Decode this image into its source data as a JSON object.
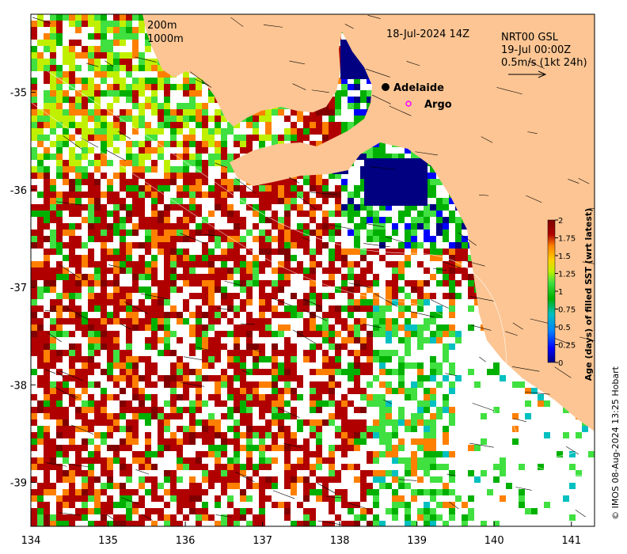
{
  "map": {
    "date_label": "18-Jul-2024 14Z",
    "depth_contours": [
      "200m",
      "1000m"
    ],
    "product_label": "NRT00 GSL",
    "current_time": "19-Jul 00:00Z",
    "vector_scale": "0.5m/s (1kt 24h)",
    "x_ticks": [
      "134",
      "135",
      "136",
      "137",
      "138",
      "139",
      "140",
      "141"
    ],
    "y_ticks": [
      "-35",
      "-36",
      "-37",
      "-38",
      "-39"
    ],
    "x_range": [
      134,
      141.3
    ],
    "y_range": [
      -39.45,
      -34.2
    ],
    "places": [
      {
        "name": "Adelaide",
        "lon": 138.6,
        "lat": -34.93,
        "marker": "filled-circle"
      },
      {
        "name": "Argo",
        "lon": 138.85,
        "lat": -35.13,
        "marker": "open-circle"
      }
    ],
    "land_color": "#fcc593",
    "credit": "© IMOS 08-Aug-2024 13:25 Hobart"
  },
  "colorbar": {
    "title": "Age (days) of filled SST (wrt latest)",
    "ticks": [
      "0",
      "0.25",
      "0.5",
      "0.75",
      "1",
      "1.25",
      "1.5",
      "1.75",
      "2"
    ],
    "range": [
      0,
      2
    ],
    "colors": [
      "#000080",
      "#0000ff",
      "#0080ff",
      "#00c0c0",
      "#00b000",
      "#40e040",
      "#c0f000",
      "#ffd000",
      "#ff8000",
      "#b00000",
      "#800000"
    ]
  }
}
